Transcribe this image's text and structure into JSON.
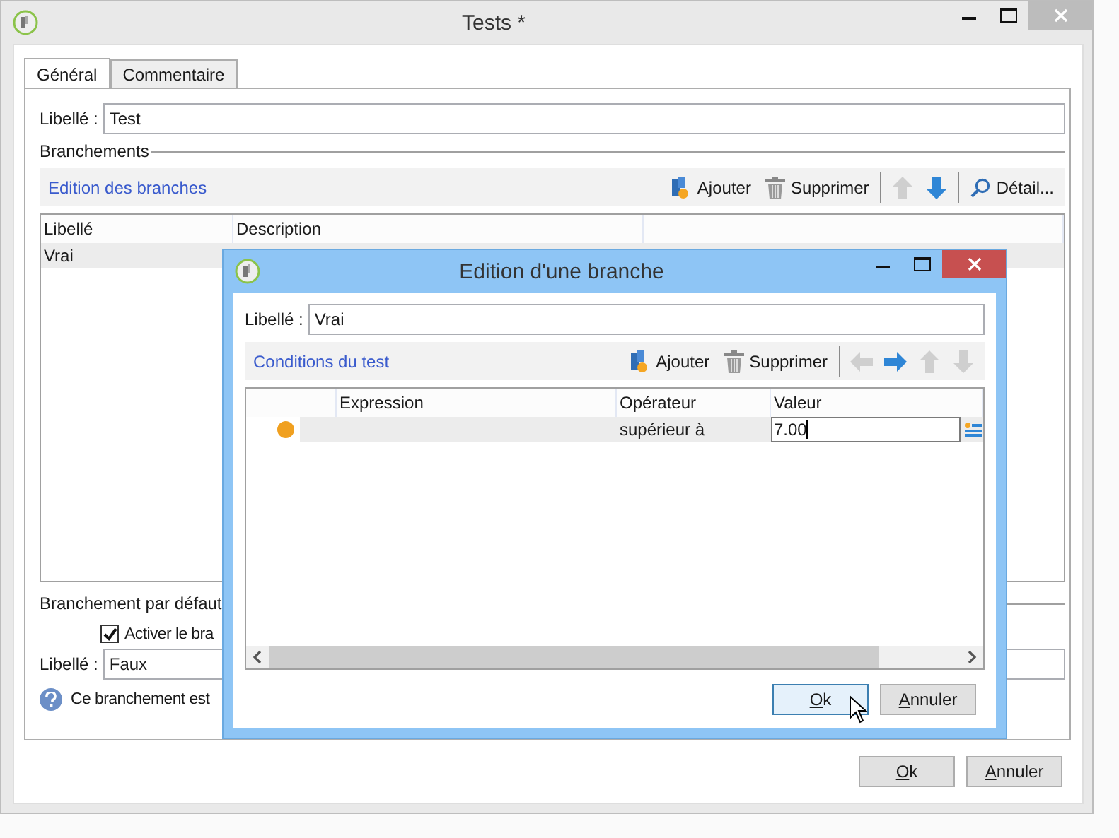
{
  "window": {
    "title": "Tests *"
  },
  "tabs": [
    {
      "label": "Général",
      "selected": true
    },
    {
      "label": "Commentaire",
      "selected": false
    }
  ],
  "label_field": {
    "label": "Libellé :",
    "value": "Test"
  },
  "branches_section": {
    "title": "Branchements"
  },
  "branches_toolbar": {
    "title": "Edition des branches",
    "add": "Ajouter",
    "delete": "Supprimer",
    "up_disabled": true,
    "down_disabled": false,
    "detail": "Détail..."
  },
  "branches_table": {
    "columns": [
      "Libellé",
      "Description"
    ],
    "rows": [
      {
        "cells": [
          "Vrai"
        ],
        "selected": true
      }
    ]
  },
  "default_section": {
    "title": "Branchement par défaut",
    "checkbox": {
      "label": "Activer le bra",
      "checked": true
    },
    "label_field": {
      "label": "Libellé :",
      "value": "Faux"
    },
    "help": "Ce branchement est"
  },
  "buttons": [
    "Ok",
    "Annuler"
  ],
  "dialog": {
    "title": "Edition d'une branche",
    "label_field": {
      "label": "Libellé :",
      "value": "Vrai"
    },
    "toolbar": {
      "title": "Conditions du test",
      "add": "Ajouter",
      "delete": "Supprimer",
      "arrows": [
        {
          "kind": "left",
          "disabled": true
        },
        {
          "kind": "right",
          "disabled": false
        },
        {
          "kind": "up",
          "disabled": true
        },
        {
          "kind": "down",
          "disabled": true
        }
      ]
    },
    "table": {
      "columns": [
        "Expression",
        "Opérateur",
        "Valeur"
      ],
      "rows": [
        {
          "color": "#f0a020",
          "operator": "supérieur à",
          "value": "7.00"
        }
      ]
    },
    "buttons": [
      {
        "label": "Ok",
        "focused": true
      },
      {
        "label": "Annuler",
        "focused": false
      }
    ]
  }
}
